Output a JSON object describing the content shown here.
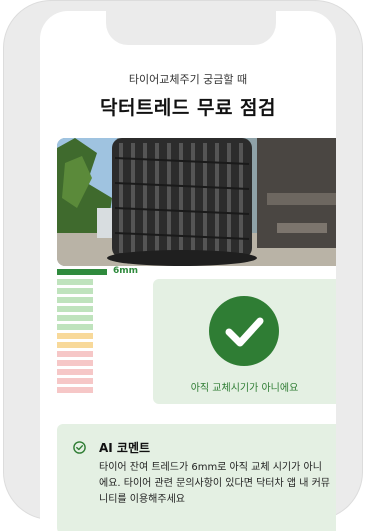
{
  "header": {
    "subtitle": "타이어교체주기 궁금할 때",
    "title": "닥터트레드 무료 점검"
  },
  "gauge": {
    "tread_depth_label": "6mm",
    "segment_colors": [
      "#bfe3bd",
      "#bfe3bd",
      "#bfe3bd",
      "#bfe3bd",
      "#bfe3bd",
      "#bfe3bd",
      "#f8d99a",
      "#f8d99a",
      "#f6c7c7",
      "#f6c7c7",
      "#f6c7c7",
      "#f6c7c7",
      "#f6c7c7"
    ],
    "level_color": "#2f8a3d"
  },
  "status": {
    "icon": "check-circle-icon",
    "text": "아직 교체시기가 아니에요",
    "color": "#2f7d34"
  },
  "ai_comment": {
    "title": "AI 코멘트",
    "body": "타이어 잔여 트레드가 6mm로 아직 교체 시기가 아니에요. 타이어 관련 문의사항이 있다면 닥터차 앱 내 커뮤니티를 이용해주세요"
  }
}
